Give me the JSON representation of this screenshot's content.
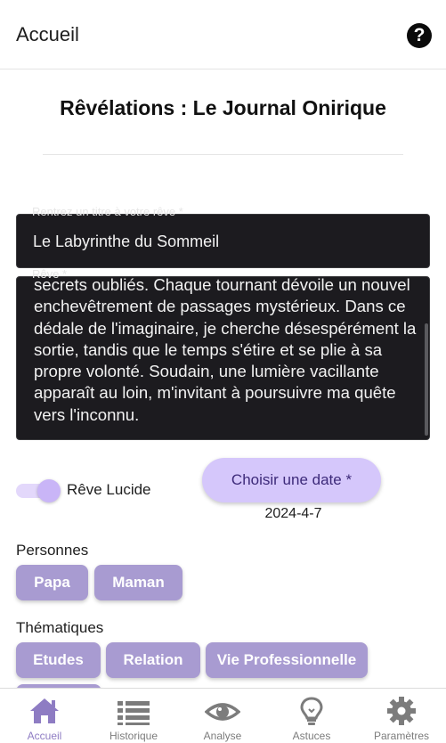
{
  "header": {
    "title": "Accueil",
    "help_icon": "question-circle-icon",
    "help_glyph": "?"
  },
  "page": {
    "title": "Rêvélations : Le Journal Onirique"
  },
  "form": {
    "title_field": {
      "label": "Rentrez un titre à votre rêve *",
      "value": "Le Labyrinthe du Sommeil"
    },
    "dream_field": {
      "label": "Rêve *",
      "value": "secrets oubliés. Chaque tournant dévoile un nouvel enchevêtrement de passages mystérieux. Dans ce dédale de l'imaginaire, je cherche désespérément la sortie, tandis que le temps s'étire et se plie à sa propre volonté. Soudain, une lumière vacillante apparaît au loin, m'invitant à poursuivre ma quête vers l'inconnu."
    },
    "lucid_toggle": {
      "label": "Rêve Lucide",
      "checked": true
    },
    "date": {
      "button_label": "Choisir une date *",
      "value": "2024-4-7"
    }
  },
  "people": {
    "label": "Personnes",
    "chips": [
      "Papa",
      "Maman"
    ]
  },
  "themes": {
    "label": "Thématiques",
    "chips": [
      "Etudes",
      "Relation",
      "Vie Professionnelle"
    ]
  },
  "nav": {
    "items": [
      {
        "label": "Accueil",
        "icon": "home-icon",
        "active": true
      },
      {
        "label": "Historique",
        "icon": "list-icon",
        "active": false
      },
      {
        "label": "Analyse",
        "icon": "eye-icon",
        "active": false
      },
      {
        "label": "Astuces",
        "icon": "lightbulb-icon",
        "active": false
      },
      {
        "label": "Paramètres",
        "icon": "gear-icon",
        "active": false
      }
    ]
  },
  "colors": {
    "accent": "#d5c7fb",
    "chip": "#a89bd1",
    "nav_active": "#8e7cc3",
    "nav_inactive": "#7c7c7c",
    "field_bg": "#1c1b1f"
  }
}
